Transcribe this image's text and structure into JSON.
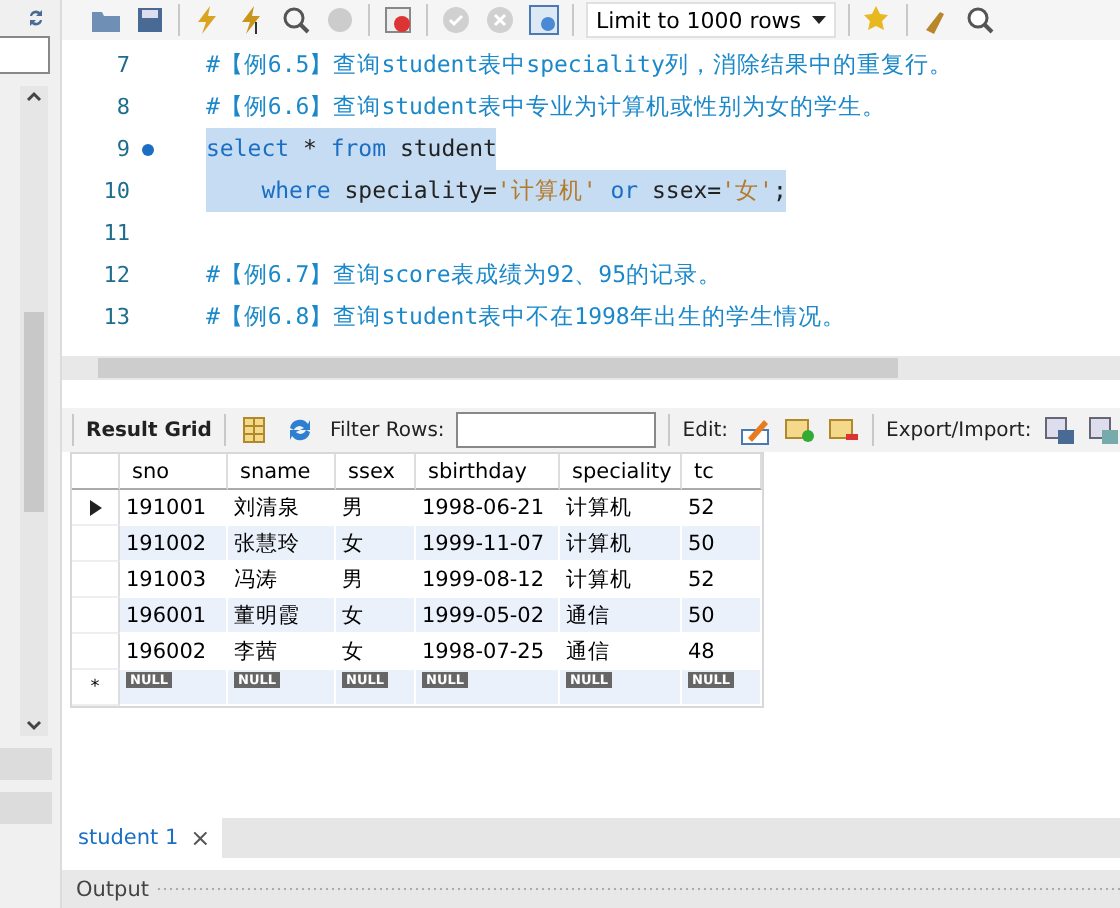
{
  "toolbar": {
    "limit_select": "Limit to 1000 rows"
  },
  "editor": {
    "lines": [
      {
        "number": "7",
        "marker": false,
        "selected": false,
        "segments": [
          {
            "kind": "comment",
            "text": "#【例6.5】查询student表中speciality列，消除结果中的重复行。"
          }
        ]
      },
      {
        "number": "8",
        "marker": false,
        "selected": false,
        "segments": [
          {
            "kind": "comment",
            "text": "#【例6.6】查询student表中专业为计算机或性别为女的学生。"
          }
        ]
      },
      {
        "number": "9",
        "marker": true,
        "selected": true,
        "segments": [
          {
            "kind": "keyword",
            "text": "select"
          },
          {
            "kind": "plain",
            "text": " * "
          },
          {
            "kind": "keyword",
            "text": "from"
          },
          {
            "kind": "plain",
            "text": " student"
          }
        ]
      },
      {
        "number": "10",
        "marker": false,
        "selected": true,
        "segments": [
          {
            "kind": "keyword",
            "text": "    where"
          },
          {
            "kind": "plain",
            "text": " speciality="
          },
          {
            "kind": "string",
            "text": "'计算机'"
          },
          {
            "kind": "keyword",
            "text": " or"
          },
          {
            "kind": "plain",
            "text": " ssex="
          },
          {
            "kind": "string",
            "text": "'女'"
          },
          {
            "kind": "plain",
            "text": ";"
          }
        ]
      },
      {
        "number": "11",
        "marker": false,
        "selected": false
      },
      {
        "number": "12",
        "marker": false,
        "selected": false,
        "segments": [
          {
            "kind": "comment",
            "text": "#【例6.7】查询score表成绩为92、95的记录。"
          }
        ]
      },
      {
        "number": "13",
        "marker": false,
        "selected": false,
        "segments": [
          {
            "kind": "comment",
            "text": "#【例6.8】查询student表中不在1998年出生的学生情况。"
          }
        ]
      }
    ]
  },
  "result_toolbar": {
    "result_grid": "Result Grid",
    "filter_label": "Filter Rows:",
    "edit_label": "Edit:",
    "export_label": "Export/Import:"
  },
  "grid": {
    "columns": [
      "sno",
      "sname",
      "ssex",
      "sbirthday",
      "speciality",
      "tc"
    ],
    "rows": [
      {
        "selected": true,
        "cells": [
          "191001",
          "刘清泉",
          "男",
          "1998-06-21",
          "计算机",
          "52"
        ]
      },
      {
        "selected": false,
        "cells": [
          "191002",
          "张慧玲",
          "女",
          "1999-11-07",
          "计算机",
          "50"
        ]
      },
      {
        "selected": false,
        "cells": [
          "191003",
          "冯涛",
          "男",
          "1999-08-12",
          "计算机",
          "52"
        ]
      },
      {
        "selected": false,
        "cells": [
          "196001",
          "董明霞",
          "女",
          "1999-05-02",
          "通信",
          "50"
        ]
      },
      {
        "selected": false,
        "cells": [
          "196002",
          "李茜",
          "女",
          "1998-07-25",
          "通信",
          "48"
        ]
      }
    ],
    "new_row": {
      "marker": "*",
      "cells": [
        "NULL",
        "NULL",
        "NULL",
        "NULL",
        "NULL",
        "NULL"
      ]
    }
  },
  "result_tabs": [
    {
      "label": "student 1",
      "selected": true,
      "close": "×"
    }
  ],
  "output_panel": {
    "title": "Output"
  }
}
